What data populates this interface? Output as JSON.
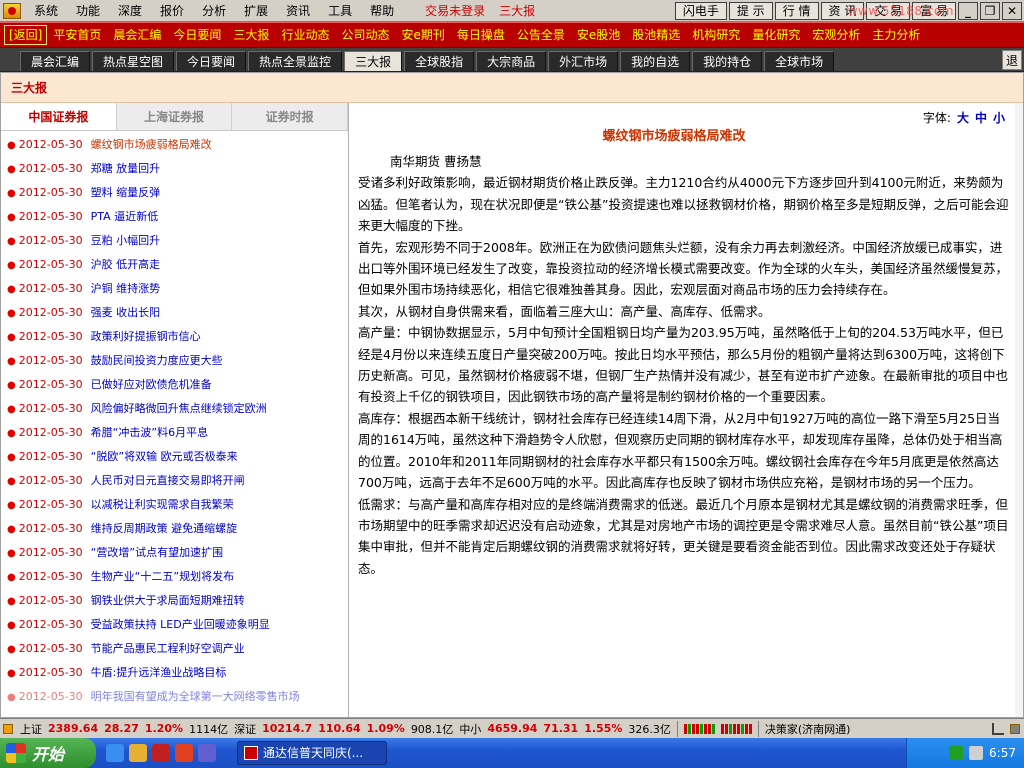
{
  "menubar": {
    "items": [
      "系统",
      "功能",
      "深度",
      "报价",
      "分析",
      "扩展",
      "资讯",
      "工具",
      "帮助"
    ],
    "status": [
      "交易未登录",
      "三大报"
    ],
    "tool_buttons": [
      "闪电手",
      "提 示",
      "行 情",
      "资 讯",
      "交 易",
      "富 易"
    ],
    "watermark": "www.55188.com"
  },
  "navbar": {
    "items": [
      "[返回]",
      "平安首页",
      "晨会汇编",
      "今日要闻",
      "三大报",
      "行业动态",
      "公司动态",
      "安e期刊",
      "每日操盘",
      "公告全景",
      "安e股池",
      "股池精选",
      "机构研究",
      "量化研究",
      "宏观分析",
      "主力分析"
    ]
  },
  "subtabs": {
    "items": [
      "晨会汇编",
      "热点星空图",
      "今日要闻",
      "热点全景监控",
      "三大报",
      "全球股指",
      "大宗商品",
      "外汇市场",
      "我的自选",
      "我的持仓",
      "全球市场"
    ],
    "active_index": 4,
    "exit_label": "退"
  },
  "section": {
    "title": "三大报"
  },
  "source_tabs": [
    "中国证券报",
    "上海证券报",
    "证券时报"
  ],
  "news": [
    {
      "date": "2012-05-30",
      "title": "螺纹钢市场疲弱格局难改"
    },
    {
      "date": "2012-05-30",
      "title": "郑糖 放量回升"
    },
    {
      "date": "2012-05-30",
      "title": "塑料 缩量反弹"
    },
    {
      "date": "2012-05-30",
      "title": "PTA 逼近新低"
    },
    {
      "date": "2012-05-30",
      "title": "豆粕 小幅回升"
    },
    {
      "date": "2012-05-30",
      "title": "沪胶 低开高走"
    },
    {
      "date": "2012-05-30",
      "title": "沪铜 维持涨势"
    },
    {
      "date": "2012-05-30",
      "title": "强麦 收出长阳"
    },
    {
      "date": "2012-05-30",
      "title": "政策利好提振钢市信心"
    },
    {
      "date": "2012-05-30",
      "title": "鼓励民间投资力度应更大些"
    },
    {
      "date": "2012-05-30",
      "title": "已做好应对欧债危机准备"
    },
    {
      "date": "2012-05-30",
      "title": "风险偏好略微回升焦点继续锁定欧洲"
    },
    {
      "date": "2012-05-30",
      "title": "希腊“冲击波”料6月平息"
    },
    {
      "date": "2012-05-30",
      "title": "“脱欧”将双输 欧元或否极泰来"
    },
    {
      "date": "2012-05-30",
      "title": "人民币对日元直接交易即将开闸"
    },
    {
      "date": "2012-05-30",
      "title": "以减税让利实现需求自我繁荣"
    },
    {
      "date": "2012-05-30",
      "title": "维持反周期政策 避免通缩螺旋"
    },
    {
      "date": "2012-05-30",
      "title": "“营改增”试点有望加速扩围"
    },
    {
      "date": "2012-05-30",
      "title": "生物产业“十二五”规划将发布"
    },
    {
      "date": "2012-05-30",
      "title": "钢铁业供大于求局面短期难扭转"
    },
    {
      "date": "2012-05-30",
      "title": "受益政策扶持 LED产业回暖迹象明显"
    },
    {
      "date": "2012-05-30",
      "title": "节能产品惠民工程利好空调产业"
    },
    {
      "date": "2012-05-30",
      "title": "牛盾:提升远洋渔业战略目标"
    },
    {
      "date": "2012-05-30",
      "title": "明年我国有望成为全球第一大网络零售市场"
    }
  ],
  "article": {
    "font_label": "字体:",
    "font_sizes": [
      "大",
      "中",
      "小"
    ],
    "title": "螺纹钢市场疲弱格局难改",
    "byline": "南华期货 曹扬慧",
    "paragraphs": [
      "受诸多利好政策影响，最近钢材期货价格止跌反弹。主力1210合约从4000元下方逐步回升到4100元附近，来势颇为凶猛。但笔者认为，现在状况即便是“铁公基”投资提速也难以拯救钢材价格，期钢价格至多是短期反弹，之后可能会迎来更大幅度的下挫。",
      "首先，宏观形势不同于2008年。欧洲正在为欧债问题焦头烂额，没有余力再去刺激经济。中国经济放缓已成事实，进出口等外围环境已经发生了改变，靠投资拉动的经济增长模式需要改变。作为全球的火车头，美国经济虽然缓慢复苏，但如果外围市场持续恶化，相信它很难独善其身。因此，宏观层面对商品市场的压力会持续存在。",
      "其次，从钢材自身供需来看，面临着三座大山：高产量、高库存、低需求。",
      "高产量：中钢协数据显示，5月中旬预计全国粗钢日均产量为203.95万吨，虽然略低于上旬的204.53万吨水平，但已经是4月份以来连续五度日产量突破200万吨。按此日均水平预估，那么5月份的粗钢产量将达到6300万吨，这将创下历史新高。可见，虽然钢材价格疲弱不堪，但钢厂生产热情并没有减少，甚至有逆市扩产迹象。在最新审批的项目中也有投资上千亿的钢铁项目，因此钢铁市场的高产量将是制约钢材价格的一个重要因素。",
      "高库存：根据西本新干线统计，钢材社会库存已经连续14周下滑，从2月中旬1927万吨的高位一路下滑至5月25日当周的1614万吨，虽然这种下滑趋势令人欣慰，但观察历史同期的钢材库存水平，却发现库存虽降，总体仍处于相当高的位置。2010年和2011年同期钢材的社会库存水平都只有1500余万吨。螺纹钢社会库存在今年5月底更是依然高达700万吨，远高于去年不足600万吨的水平。因此高库存也反映了钢材市场供应充裕，是钢材市场的另一个压力。",
      "低需求：与高产量和高库存相对应的是终端消费需求的低迷。最近几个月原本是钢材尤其是螺纹钢的消费需求旺季，但市场期望中的旺季需求却迟迟没有启动迹象，尤其是对房地产市场的调控更是令需求难尽人意。虽然目前“铁公基”项目集中审批，但并不能肯定后期螺纹钢的消费需求就将好转，更关键是要看资金能否到位。因此需求改变还处于存疑状态。"
    ]
  },
  "ticker": {
    "sh_label": "上证",
    "sh_value": "2389.64",
    "sh_change": "28.27",
    "sh_pct": "1.20%",
    "sh_amount": "1114亿",
    "sz_label": "深证",
    "sz_value": "10214.7",
    "sz_change": "110.64",
    "sz_pct": "1.09%",
    "sz_amount": "908.1亿",
    "zx_label": "中小",
    "zx_value": "4659.94",
    "zx_change": "71.31",
    "zx_pct": "1.55%",
    "zx_amount": "326.3亿",
    "broker": "决策家(济南网通)"
  },
  "taskbar": {
    "start_label": "开始",
    "task_label": "通达信普天同庆(...",
    "clock": "6:57"
  },
  "colors": {
    "nav_bg": "#b80000",
    "nav_text": "#ffff00",
    "accent_red": "#c00000",
    "link_blue": "#0000cc"
  }
}
